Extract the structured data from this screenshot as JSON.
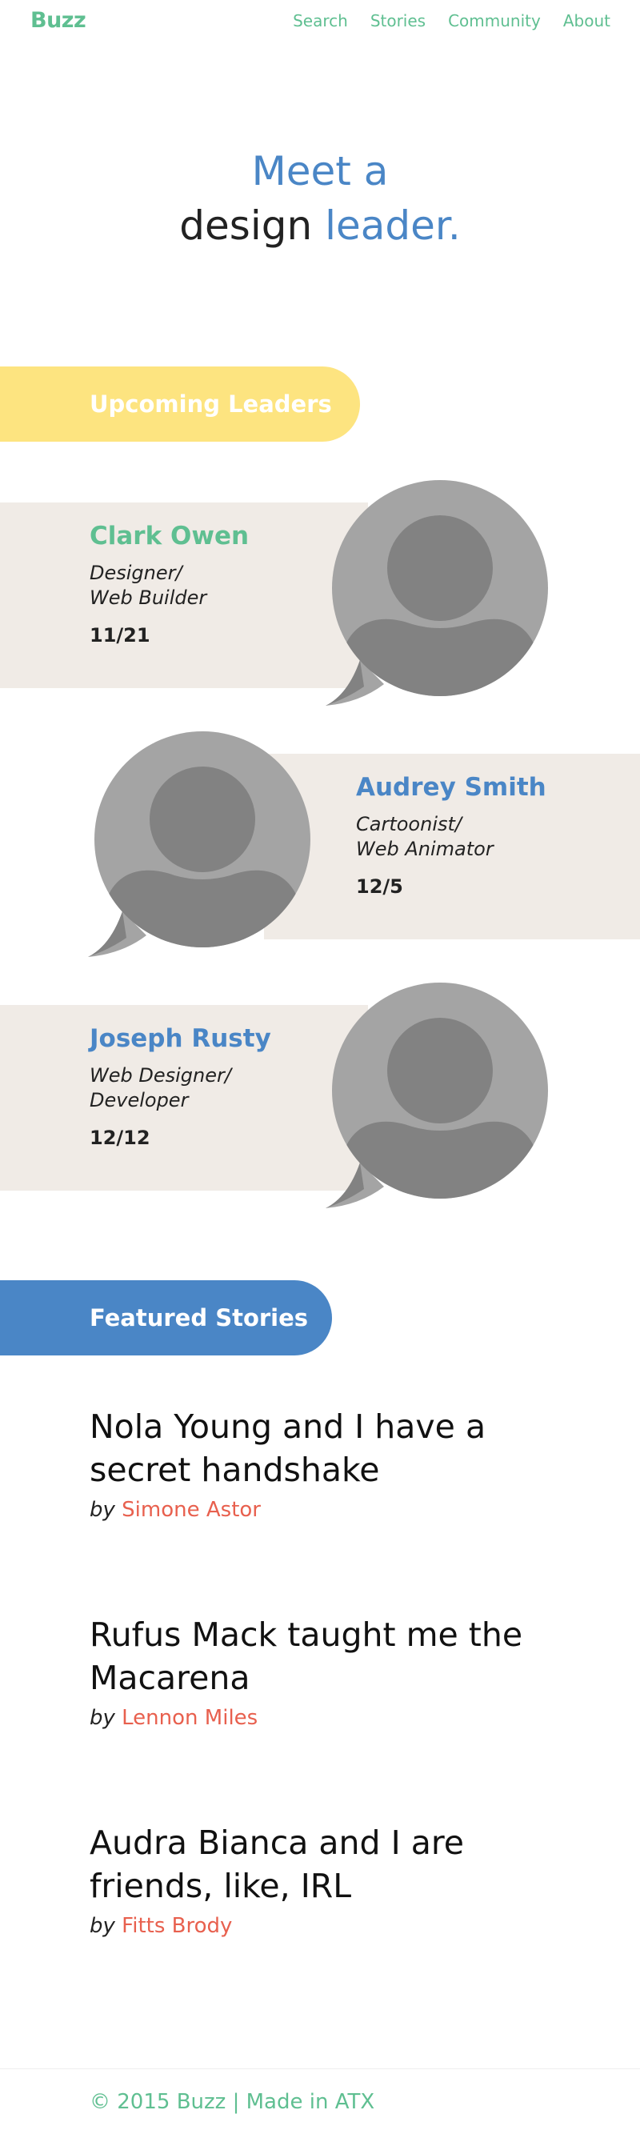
{
  "header": {
    "logo": "Buzz",
    "nav": [
      "Search",
      "Stories",
      "Community",
      "About"
    ]
  },
  "hero": {
    "line1": "Meet a",
    "line2_dark": "design",
    "line2_blue": "leader."
  },
  "upcoming": {
    "heading": "Upcoming Leaders",
    "leaders": [
      {
        "name": "Clark Owen",
        "role_line1": "Designer/",
        "role_line2": "Web Builder",
        "date": "11/21"
      },
      {
        "name": "Audrey Smith",
        "role_line1": "Cartoonist/",
        "role_line2": "Web Animator",
        "date": "12/5"
      },
      {
        "name": "Joseph Rusty",
        "role_line1": "Web Designer/",
        "role_line2": "Developer",
        "date": "12/12"
      }
    ]
  },
  "featured": {
    "heading": "Featured Stories",
    "stories": [
      {
        "title": "Nola Young and I have a secret handshake",
        "by": "by",
        "author": "Simone Astor"
      },
      {
        "title": "Rufus Mack taught me the Macarena",
        "by": "by",
        "author": "Lennon Miles"
      },
      {
        "title": "Audra Bianca and I are friends, like, IRL",
        "by": "by",
        "author": "Fitts Brody"
      }
    ]
  },
  "footer": {
    "text": "© 2015 Buzz | Made in ATX"
  },
  "colors": {
    "green": "#5fbf91",
    "blue": "#4a86c6",
    "yellow": "#fde480",
    "card_bg": "#f0ebe6",
    "author_red": "#e8604e"
  }
}
